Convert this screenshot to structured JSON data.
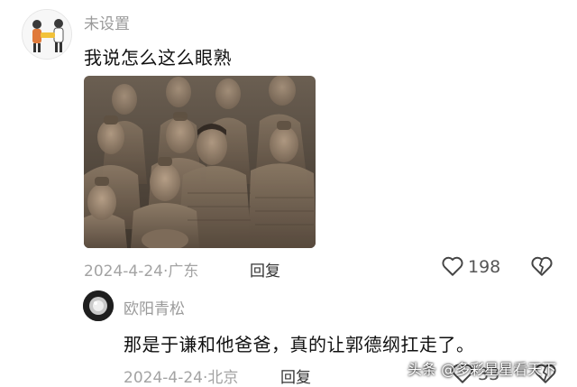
{
  "comment1": {
    "username": "未设置",
    "text": "我说怎么这么眼熟",
    "date": "2024-4-24",
    "location": "广东",
    "reply_label": "回复",
    "like_count": "198"
  },
  "comment2": {
    "username": "欧阳青松",
    "text": "那是于谦和他爸爸，真的让郭德纲扛走了。",
    "date": "2024-4-24",
    "location": "北京",
    "reply_label": "回复",
    "like_count": "33"
  },
  "watermark": "头条 @多彩星星看天下"
}
